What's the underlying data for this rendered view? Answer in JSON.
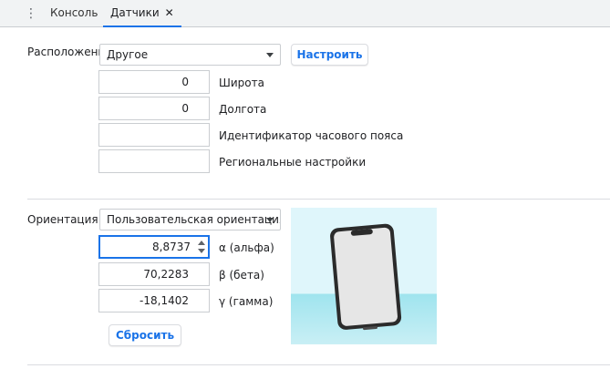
{
  "tabs": [
    {
      "label": "Консоль"
    },
    {
      "label": "Датчики"
    }
  ],
  "location": {
    "label": "Расположение",
    "select_value": "Другое",
    "configure_button": "Настроить",
    "latitude": {
      "value": "0",
      "label": "Широта"
    },
    "longitude": {
      "value": "0",
      "label": "Долгота"
    },
    "timezone": {
      "value": "",
      "label": "Идентификатор часового пояса"
    },
    "locale": {
      "value": "",
      "label": "Региональные настройки"
    }
  },
  "orientation": {
    "label": "Ориентация",
    "select_value": "Пользовательская ориентация",
    "alpha": {
      "value": "8,8737",
      "label": "α (альфа)"
    },
    "beta": {
      "value": "70,2283",
      "label": "β (бета)"
    },
    "gamma": {
      "value": "-18,1402",
      "label": "γ (гамма)"
    },
    "reset_button": "Сбросить"
  },
  "colors": {
    "accent": "#1a73e8",
    "sky": "#dff6fb",
    "ground": "#9fe4ee"
  }
}
